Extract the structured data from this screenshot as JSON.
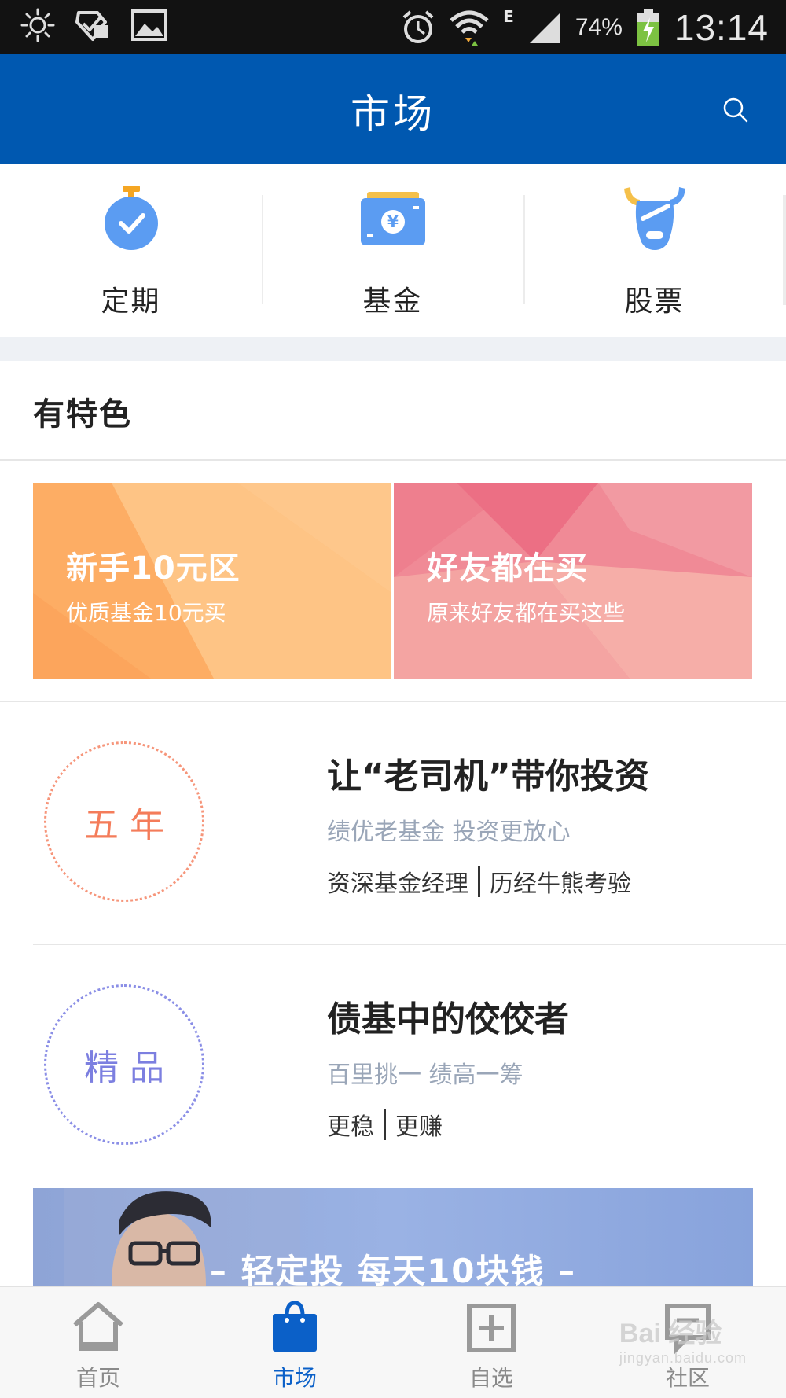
{
  "status_bar": {
    "left_icons": [
      "brightness-icon",
      "shield-check-icon",
      "image-icon"
    ],
    "right_icons": [
      "alarm-icon",
      "wifi-icon",
      "signal-icon",
      "battery-charging-icon"
    ],
    "network": "E",
    "battery": "74%",
    "time": "13:14"
  },
  "header": {
    "title": "市场",
    "search_icon": "search-icon",
    "color": "#0058b0"
  },
  "categories": [
    {
      "label": "定期",
      "icon": "stopwatch-icon"
    },
    {
      "label": "基金",
      "icon": "wallet-yen-icon"
    },
    {
      "label": "股票",
      "icon": "bull-icon"
    }
  ],
  "section": {
    "title": "有特色"
  },
  "banners": [
    {
      "title": "新手10元区",
      "subtitle": "优质基金10元买",
      "color": "#fdb873"
    },
    {
      "title": "好友都在买",
      "subtitle": "原来好友都在买这些",
      "color": "#f08a96"
    }
  ],
  "features": [
    {
      "badge": "五年",
      "badge_color": "#f47c5a",
      "title": "让“老司机”带你投资",
      "subtitle": "绩优老基金 投资更放心",
      "tags": [
        "资深基金经理",
        "历经牛熊考验"
      ]
    },
    {
      "badge": "精品",
      "badge_color": "#7c7fe0",
      "title": "债基中的佼佼者",
      "subtitle": "百里挑一 绩高一筹",
      "tags": [
        "更稳",
        "更赚"
      ]
    }
  ],
  "promo": {
    "text": "– 轻定投 每天10块钱 –"
  },
  "tabbar": {
    "active_color": "#0b60c8",
    "items": [
      {
        "label": "首页",
        "icon": "home-icon",
        "active": false
      },
      {
        "label": "市场",
        "icon": "shopping-bag-icon",
        "active": true
      },
      {
        "label": "自选",
        "icon": "add-box-icon",
        "active": false
      },
      {
        "label": "社区",
        "icon": "community-icon",
        "active": false
      }
    ]
  },
  "watermark": {
    "brand": "Bai 经验",
    "url": "jingyan.baidu.com"
  }
}
